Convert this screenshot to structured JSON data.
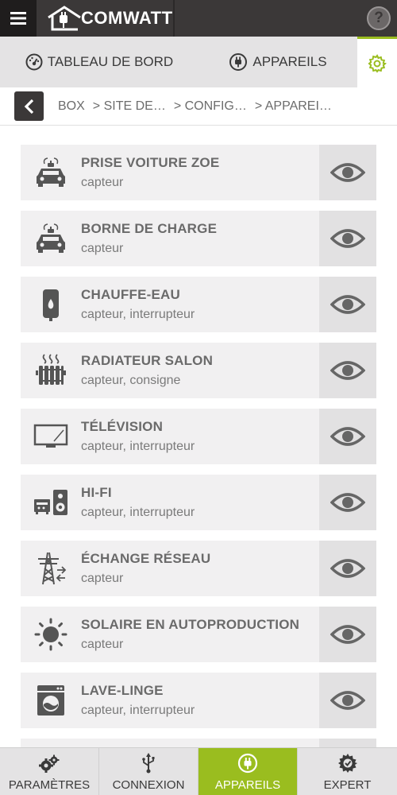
{
  "app": {
    "logo_text": "COMWATT"
  },
  "nav": {
    "tabs": [
      {
        "label": "TABLEAU DE BORD",
        "icon": "dashboard-gauge-icon"
      },
      {
        "label": "APPAREILS",
        "icon": "plug-icon"
      },
      {
        "label": "",
        "icon": "gear-icon",
        "active": true
      }
    ]
  },
  "breadcrumb": {
    "items": [
      "BOX",
      "> SITE DE…",
      "> CONFIG…",
      "> APPAREI…"
    ]
  },
  "devices": [
    {
      "title": "PRISE VOITURE ZOE",
      "subtitle": "capteur",
      "icon": "electric-car-icon"
    },
    {
      "title": "BORNE DE CHARGE",
      "subtitle": "capteur",
      "icon": "electric-car-icon"
    },
    {
      "title": "CHAUFFE-EAU",
      "subtitle": "capteur, interrupteur",
      "icon": "water-heater-icon"
    },
    {
      "title": "RADIATEUR SALON",
      "subtitle": "capteur, consigne",
      "icon": "radiator-icon"
    },
    {
      "title": "TÉLÉVISION",
      "subtitle": "capteur, interrupteur",
      "icon": "television-icon"
    },
    {
      "title": "HI-FI",
      "subtitle": "capteur, interrupteur",
      "icon": "hifi-icon"
    },
    {
      "title": "ÉCHANGE RÉSEAU",
      "subtitle": "capteur",
      "icon": "power-pylon-icon"
    },
    {
      "title": "SOLAIRE EN AUTOPRODUCTION",
      "subtitle": "capteur",
      "icon": "sun-icon"
    },
    {
      "title": "LAVE-LINGE",
      "subtitle": "capteur, interrupteur",
      "icon": "washing-machine-icon"
    }
  ],
  "bottom_tabs": [
    {
      "label": "PARAMÈTRES",
      "icon": "gears-icon"
    },
    {
      "label": "CONNEXION",
      "icon": "usb-icon"
    },
    {
      "label": "APPAREILS",
      "icon": "plug-circle-icon",
      "active": true
    },
    {
      "label": "EXPERT",
      "icon": "expert-gear-icon"
    }
  ],
  "colors": {
    "accent": "#9abd1f",
    "topbar": "#3b3838",
    "nav_bg": "#e4e3e4",
    "row_bg": "#f1f0f1"
  }
}
